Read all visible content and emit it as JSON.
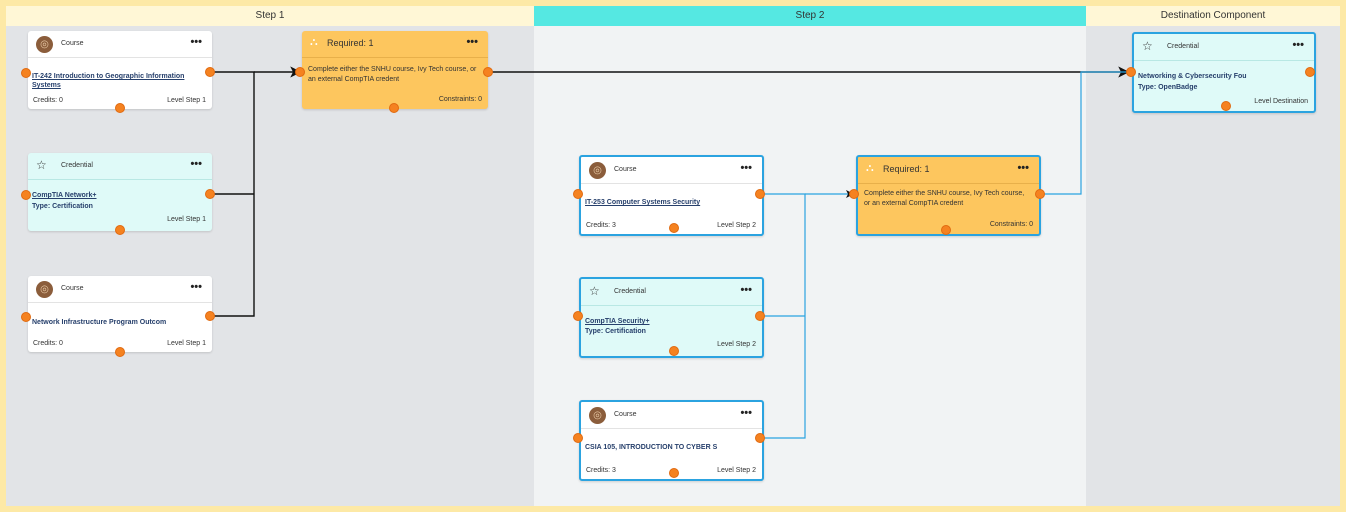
{
  "columns": {
    "step1": "Step 1",
    "step2": "Step 2",
    "destination": "Destination Component"
  },
  "cards": {
    "course1": {
      "type": "Course",
      "title": "IT-242 Introduction to Geographic Information Systems",
      "credits": "Credits: 0",
      "level": "Level Step 1"
    },
    "cred1": {
      "type": "Credential",
      "title": "CompTIA Network+",
      "subtype": "Type: Certification",
      "level": "Level Step 1"
    },
    "course2": {
      "type": "Course",
      "title": "Network Infrastructure Program Outcom",
      "credits": "Credits: 0",
      "level": "Level Step 1"
    },
    "req1": {
      "type": "Required: 1",
      "description": "Complete either the SNHU course, Ivy Tech course, or an external CompTIA credent",
      "constraints": "Constraints: 0"
    },
    "course3": {
      "type": "Course",
      "title": "IT-253 Computer Systems Security",
      "credits": "Credits: 3",
      "level": "Level Step 2"
    },
    "cred2": {
      "type": "Credential",
      "title": "CompTIA Security+",
      "subtype": "Type: Certification",
      "level": "Level Step 2"
    },
    "course4": {
      "type": "Course",
      "title": "CSIA 105, INTRODUCTION TO CYBER S",
      "credits": "Credits: 3",
      "level": "Level Step 2"
    },
    "req2": {
      "type": "Required: 1",
      "description": "Complete either the SNHU course, Ivy Tech course, or an external CompTIA credent",
      "constraints": "Constraints: 0"
    },
    "dest": {
      "type": "Credential",
      "title": "Networking & Cybersecurity Fou",
      "subtype": "Type: OpenBadge",
      "level": "Level Destination"
    }
  },
  "menu_glyph": "•••",
  "colors": {
    "accent_selected": "#2ba3e0",
    "connector_dot": "#f58220",
    "requirement_card": "#fdc65e",
    "credential_card": "#dffaf8",
    "step2_header": "#55e8e2"
  }
}
